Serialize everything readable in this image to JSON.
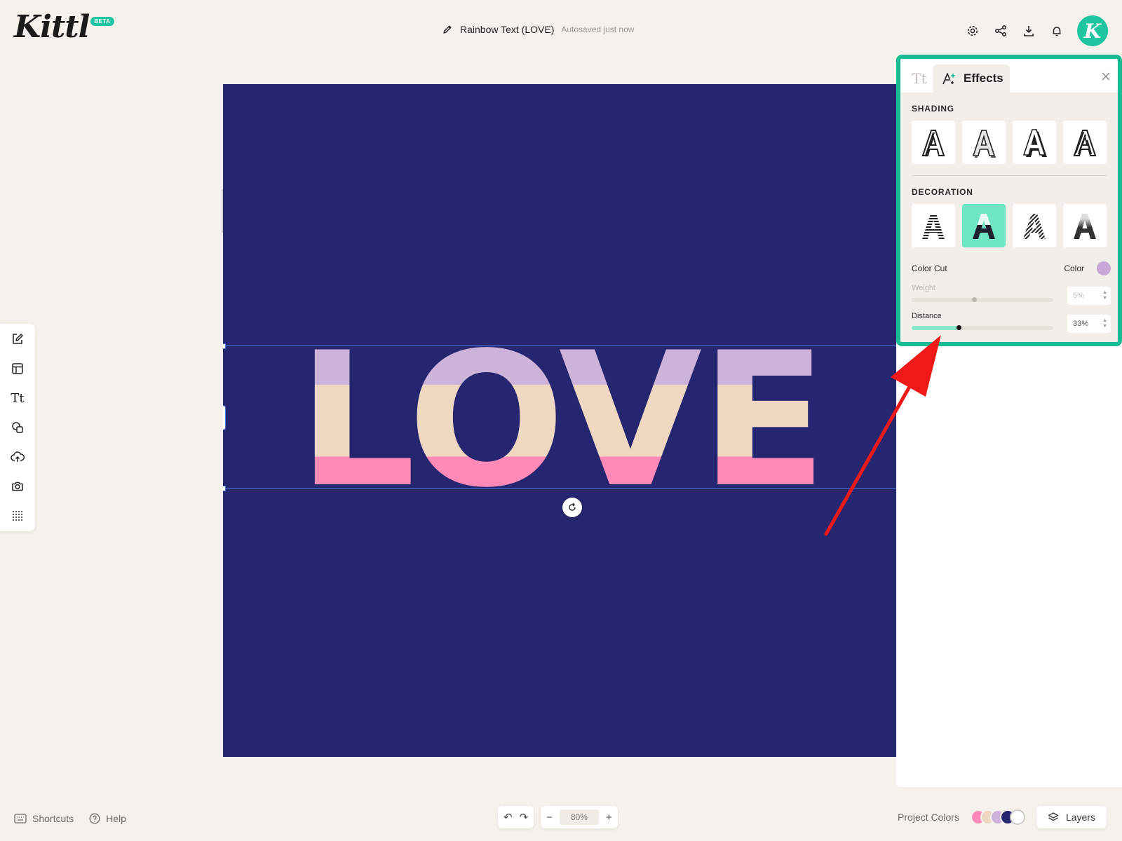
{
  "app": {
    "logo": "Kittl",
    "badge": "BETA"
  },
  "document": {
    "title": "Rainbow Text (LOVE)",
    "autosave": "Autosaved just now"
  },
  "header_icons": [
    "gear-icon",
    "share-icon",
    "download-icon",
    "bell-icon"
  ],
  "avatar": {
    "initial": "K",
    "color": "#1fc4a0"
  },
  "canvas": {
    "background": "#262670",
    "text": "LOVE",
    "stripe_colors": [
      "#cdb2d9",
      "#efd8c2",
      "#ff8ab8"
    ]
  },
  "toolbar_icons": [
    "edit-icon",
    "templates-icon",
    "text-icon",
    "shapes-icon",
    "upload-icon",
    "camera-icon",
    "pattern-icon"
  ],
  "panel": {
    "tab_text": "Tt",
    "tab_effects": "Effects",
    "shading_title": "SHADING",
    "decoration_title": "DECORATION",
    "decoration_active_index": 1,
    "color_cut_label": "Color Cut",
    "color_label": "Color",
    "color_value": "#c8a8d8",
    "weight": {
      "label": "Weight",
      "value": "5%",
      "fraction": 0.44
    },
    "distance": {
      "label": "Distance",
      "value": "33%",
      "fraction": 0.33
    },
    "accent": "#18bc94"
  },
  "bottom": {
    "shortcuts": "Shortcuts",
    "help": "Help",
    "zoom": "80%",
    "project_colors": "Project Colors",
    "layers": "Layers",
    "palette": [
      "#ff8ab8",
      "#efd8c2",
      "#cdb2d9",
      "#262670"
    ]
  }
}
